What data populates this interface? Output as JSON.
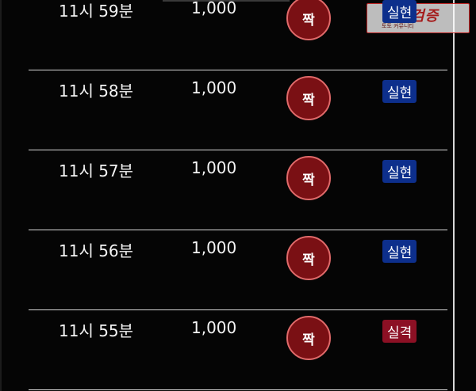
{
  "watermark": {
    "logo": "먹튀검증",
    "sub": "토토 커뮤니티"
  },
  "colors": {
    "win": "#0d2f8c",
    "lose": "#8c1024",
    "bet_circle": "#7a1014"
  },
  "rows": [
    {
      "time": "11시 59분",
      "amount": "1,000",
      "bet": "짝",
      "result": "실현",
      "status": "win"
    },
    {
      "time": "11시 58분",
      "amount": "1,000",
      "bet": "짝",
      "result": "실현",
      "status": "win"
    },
    {
      "time": "11시 57분",
      "amount": "1,000",
      "bet": "짝",
      "result": "실현",
      "status": "win"
    },
    {
      "time": "11시 56분",
      "amount": "1,000",
      "bet": "짝",
      "result": "실현",
      "status": "win"
    },
    {
      "time": "11시 55분",
      "amount": "1,000",
      "bet": "짝",
      "result": "실격",
      "status": "lose"
    }
  ]
}
